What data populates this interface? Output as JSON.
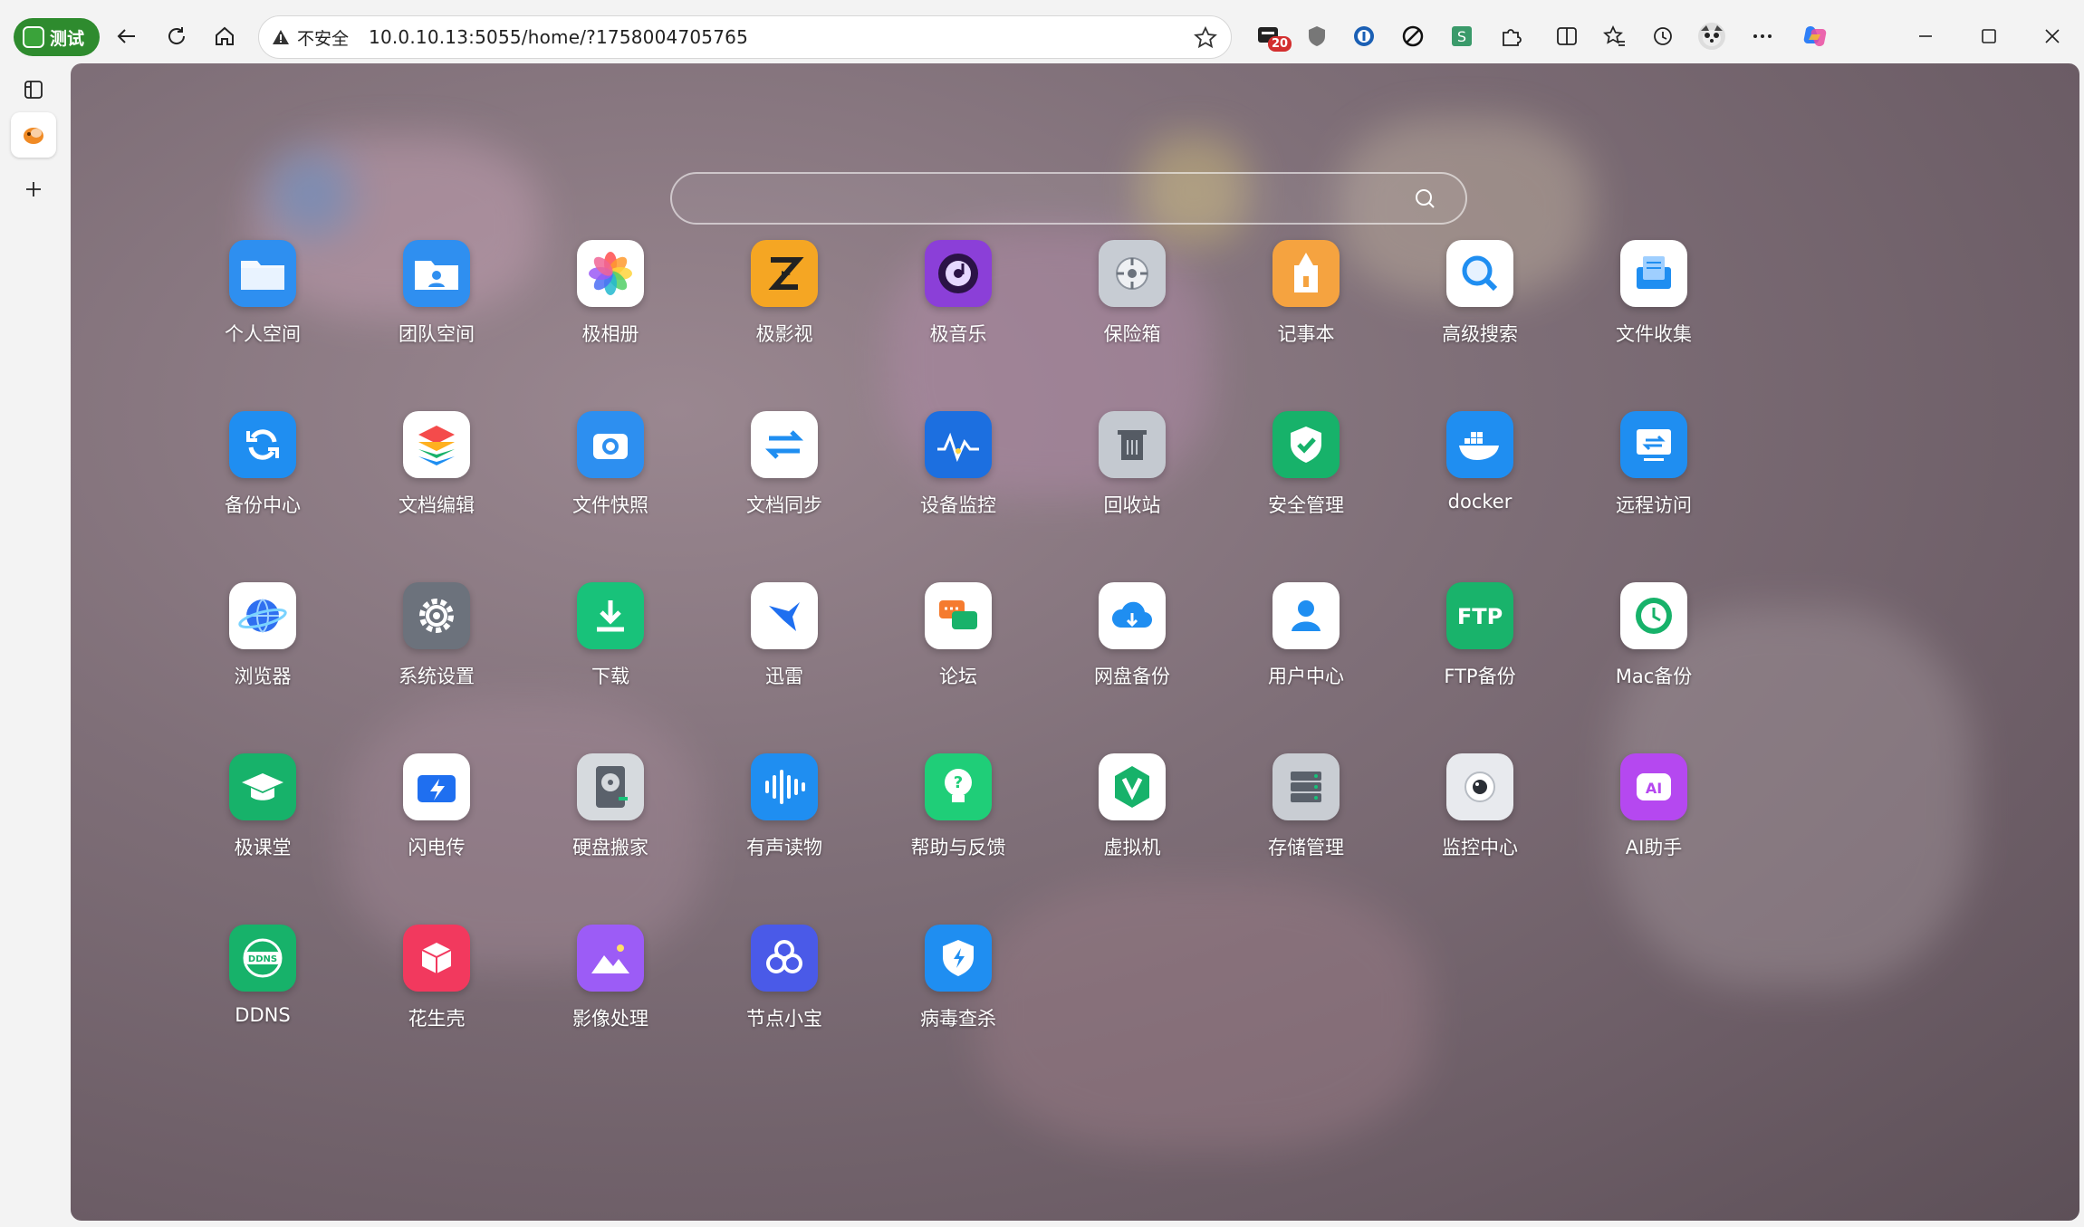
{
  "browser": {
    "profile_label": "测试",
    "security_label": "不安全",
    "url": "10.0.10.13:5055/home/?1758004705765",
    "notification_badge": "20"
  },
  "search": {
    "placeholder": ""
  },
  "apps": [
    {
      "label": "个人空间",
      "icon": "folder-icon",
      "color": "#2e8ff0"
    },
    {
      "label": "团队空间",
      "icon": "team-folder-icon",
      "color": "#2f8ff0"
    },
    {
      "label": "极相册",
      "icon": "photos-flower-icon",
      "color": "#ffffff"
    },
    {
      "label": "极影视",
      "icon": "video-icon",
      "color": "#f5a623"
    },
    {
      "label": "极音乐",
      "icon": "music-disc-icon",
      "color": "#8b3fd8"
    },
    {
      "label": "保险箱",
      "icon": "safe-icon",
      "color": "#c7ccd3"
    },
    {
      "label": "记事本",
      "icon": "notepad-icon",
      "color": "#f5a340"
    },
    {
      "label": "高级搜索",
      "icon": "magnifier-icon",
      "color": "#ffffff"
    },
    {
      "label": "文件收集",
      "icon": "file-collect-icon",
      "color": "#ffffff"
    },
    {
      "label": "备份中心",
      "icon": "backup-sync-icon",
      "color": "#1f8ef1"
    },
    {
      "label": "文档编辑",
      "icon": "layers-icon",
      "color": "#ffffff"
    },
    {
      "label": "文件快照",
      "icon": "camera-icon",
      "color": "#2d8ff0"
    },
    {
      "label": "文档同步",
      "icon": "sync-arrows-icon",
      "color": "#ffffff"
    },
    {
      "label": "设备监控",
      "icon": "monitor-wave-icon",
      "color": "#1c6fe0"
    },
    {
      "label": "回收站",
      "icon": "trash-icon",
      "color": "#c4c9d0"
    },
    {
      "label": "安全管理",
      "icon": "shield-check-icon",
      "color": "#17b26a"
    },
    {
      "label": "docker",
      "icon": "docker-whale-icon",
      "color": "#1f8ef1"
    },
    {
      "label": "远程访问",
      "icon": "remote-access-icon",
      "color": "#1f8ef1"
    },
    {
      "label": "浏览器",
      "icon": "browser-globe-icon",
      "color": "#ffffff"
    },
    {
      "label": "系统设置",
      "icon": "gear-icon",
      "color": "#6c727c"
    },
    {
      "label": "下载",
      "icon": "download-icon",
      "color": "#18c27a"
    },
    {
      "label": "迅雷",
      "icon": "thunder-bird-icon",
      "color": "#ffffff"
    },
    {
      "label": "论坛",
      "icon": "forum-chat-icon",
      "color": "#ffffff"
    },
    {
      "label": "网盘备份",
      "icon": "cloud-backup-icon",
      "color": "#ffffff"
    },
    {
      "label": "用户中心",
      "icon": "user-icon",
      "color": "#ffffff"
    },
    {
      "label": "FTP备份",
      "icon": "ftp-icon",
      "color": "#19b36b"
    },
    {
      "label": "Mac备份",
      "icon": "time-machine-icon",
      "color": "#ffffff"
    },
    {
      "label": "极课堂",
      "icon": "graduation-cap-icon",
      "color": "#17b26a"
    },
    {
      "label": "闪电传",
      "icon": "flash-transfer-icon",
      "color": "#ffffff"
    },
    {
      "label": "硬盘搬家",
      "icon": "disk-move-icon",
      "color": "#d6dade"
    },
    {
      "label": "有声读物",
      "icon": "audio-wave-icon",
      "color": "#1f8ef1"
    },
    {
      "label": "帮助与反馈",
      "icon": "lightbulb-icon",
      "color": "#1fce78"
    },
    {
      "label": "虚拟机",
      "icon": "vm-v-icon",
      "color": "#ffffff"
    },
    {
      "label": "存储管理",
      "icon": "storage-server-icon",
      "color": "#c9cdd3"
    },
    {
      "label": "监控中心",
      "icon": "webcam-icon",
      "color": "#e8eaee"
    },
    {
      "label": "AI助手",
      "icon": "ai-robot-icon",
      "color": "#b548f0"
    },
    {
      "label": "DDNS",
      "icon": "ddns-globe-icon",
      "color": "#17b26a"
    },
    {
      "label": "花生壳",
      "icon": "peanut-cube-icon",
      "color": "#f2395e"
    },
    {
      "label": "影像处理",
      "icon": "image-mountain-icon",
      "color": "#9c5cf6"
    },
    {
      "label": "节点小宝",
      "icon": "node-knot-icon",
      "color": "#4a5ae8"
    },
    {
      "label": "病毒查杀",
      "icon": "antivirus-shield-icon",
      "color": "#1f8ef1"
    }
  ]
}
